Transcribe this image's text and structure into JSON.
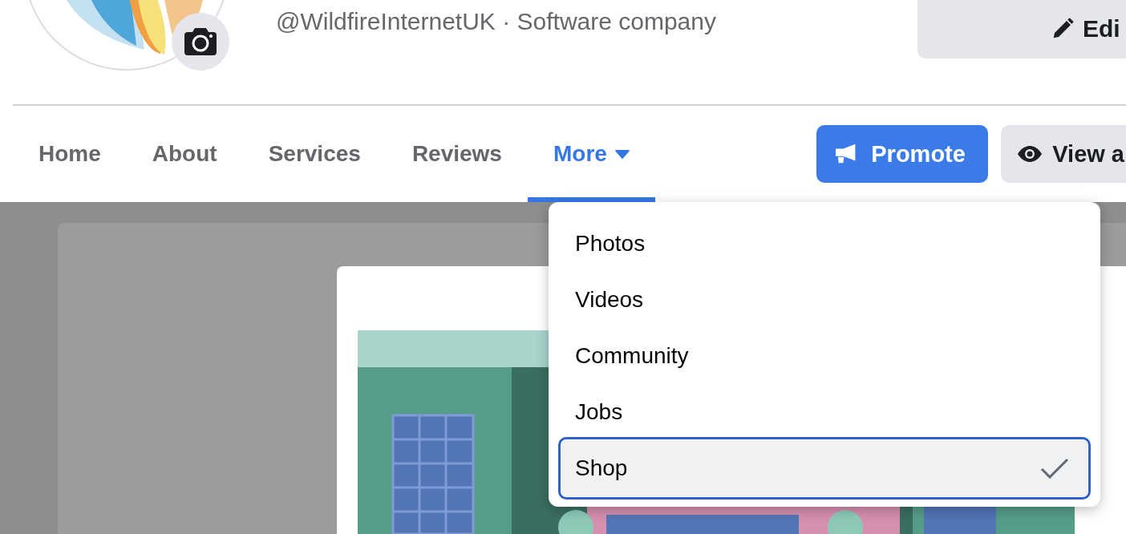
{
  "profile": {
    "handle": "@WildfireInternetUK · Software company",
    "edit_button": "Edi"
  },
  "tabs": [
    {
      "label": "Home",
      "kind": "link",
      "selected": false
    },
    {
      "label": "About",
      "kind": "link",
      "selected": false
    },
    {
      "label": "Services",
      "kind": "link",
      "selected": false
    },
    {
      "label": "Reviews",
      "kind": "link",
      "selected": false
    },
    {
      "label": "More",
      "kind": "dropdown",
      "selected": true
    }
  ],
  "actions": [
    {
      "label": "Promote",
      "kind": "primary"
    },
    {
      "label": "View a",
      "kind": "secondary"
    }
  ],
  "menu": {
    "items": [
      {
        "label": "Photos",
        "selected": false
      },
      {
        "label": "Videos",
        "selected": false
      },
      {
        "label": "Community",
        "selected": false
      },
      {
        "label": "Jobs",
        "selected": false
      },
      {
        "label": "Shop",
        "selected": true
      }
    ]
  }
}
